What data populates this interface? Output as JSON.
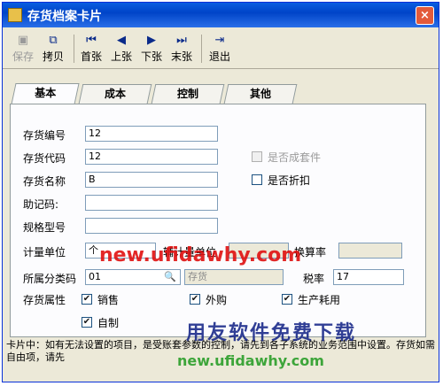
{
  "window": {
    "title": "存货档案卡片",
    "close_glyph": "×"
  },
  "toolbar": {
    "buttons": [
      {
        "label": "保存",
        "icon": "save-icon",
        "glyph": "▣"
      },
      {
        "label": "拷贝",
        "icon": "copy-icon",
        "glyph": "⧉"
      },
      {
        "label": "首张",
        "icon": "first-record-icon",
        "glyph": "⏮"
      },
      {
        "label": "上张",
        "icon": "previous-record-icon",
        "glyph": "◀"
      },
      {
        "label": "下张",
        "icon": "next-record-icon",
        "glyph": "▶"
      },
      {
        "label": "末张",
        "icon": "last-record-icon",
        "glyph": "⏭"
      },
      {
        "label": "退出",
        "icon": "exit-icon",
        "glyph": "⇥"
      }
    ]
  },
  "tabs": [
    "基本",
    "成本",
    "控制",
    "其他"
  ],
  "form": {
    "code_label": "存货编号",
    "code_value": "12",
    "alias_label": "存货代码",
    "alias_value": "12",
    "name_label": "存货名称",
    "name_value": "B",
    "mnemonic_label": "助记码:",
    "mnemonic_value": "",
    "spec_label": "规格型号",
    "spec_value": "",
    "unit_label": "计量单位",
    "unit_value": "个",
    "aux_unit_label": "辅计量单位",
    "aux_unit_value": "",
    "conversion_label": "换算率",
    "conversion_value": "",
    "category_label": "所属分类码",
    "category_value": "01",
    "category_name": "存货",
    "tax_label": "税率",
    "tax_value": "17",
    "attribute_label": "存货属性",
    "is_set_label": "是否成套件",
    "is_discount_label": "是否折扣",
    "attributes": [
      {
        "label": "销售",
        "checked": "✔"
      },
      {
        "label": "外购",
        "checked": "✔"
      },
      {
        "label": "生产耗用",
        "checked": "✔"
      },
      {
        "label": "自制",
        "checked": "✔"
      }
    ],
    "lookup_glyph": "🔍"
  },
  "status_text": "卡片中：如有无法设置的项目，是受账套参数的控制，请先到各子系统的业务范围中设置。存货如需自由项，请先",
  "watermarks": {
    "url_red": "new.ufidawhy.com",
    "slogan": "用友软件免费下载",
    "url_green": "new.ufidawhy.com"
  },
  "colors": {
    "title_bar": "#0a5ee0",
    "watermark_red": "#e01010",
    "watermark_green": "#1f9a1f"
  }
}
